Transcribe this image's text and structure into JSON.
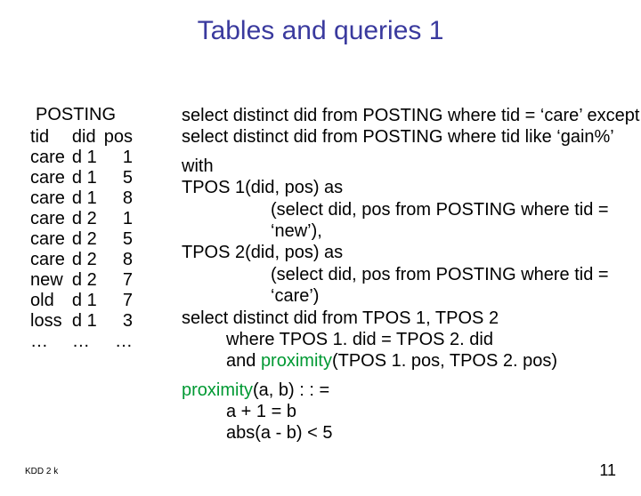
{
  "title": "Tables and queries 1",
  "table": {
    "name": "POSTING",
    "headers": {
      "c0": "tid",
      "c1": "did",
      "c2": "pos"
    },
    "rows": [
      {
        "c0": "care",
        "c1": "d 1",
        "c2": "1"
      },
      {
        "c0": "care",
        "c1": "d 1",
        "c2": "5"
      },
      {
        "c0": "care",
        "c1": "d 1",
        "c2": "8"
      },
      {
        "c0": "care",
        "c1": "d 2",
        "c2": "1"
      },
      {
        "c0": "care",
        "c1": "d 2",
        "c2": "5"
      },
      {
        "c0": "care",
        "c1": "d 2",
        "c2": "8"
      },
      {
        "c0": "new",
        "c1": "d 2",
        "c2": "7"
      },
      {
        "c0": "old",
        "c1": "d 1",
        "c2": "7"
      },
      {
        "c0": "loss",
        "c1": "d 1",
        "c2": "3"
      }
    ],
    "ellipsis": {
      "c0": "…",
      "c1": "…",
      "c2": "…"
    }
  },
  "q1": {
    "l1": "select distinct did from POSTING where tid = ‘care’ except",
    "l2": "select distinct did from POSTING where tid like ‘gain%’"
  },
  "q2": {
    "l1": "with",
    "l2": "TPOS 1(did, pos) as",
    "l3": "(select did, pos from POSTING where tid = ‘new’),",
    "l4": "TPOS 2(did, pos) as",
    "l5": "(select did, pos from POSTING where tid = ‘care’)",
    "l6": "select distinct did from TPOS 1, TPOS 2",
    "l7": "where TPOS 1. did = TPOS 2. did",
    "l8a": "and ",
    "l8b": "proximity",
    "l8c": "(TPOS 1. pos, TPOS 2. pos)"
  },
  "q3": {
    "l1a": "proximity",
    "l1b": "(a, b) : : =",
    "l2": "a + 1 = b",
    "l3": "abs(a - b) < 5"
  },
  "footer": {
    "left": "KDD 2 k",
    "right": "11"
  }
}
